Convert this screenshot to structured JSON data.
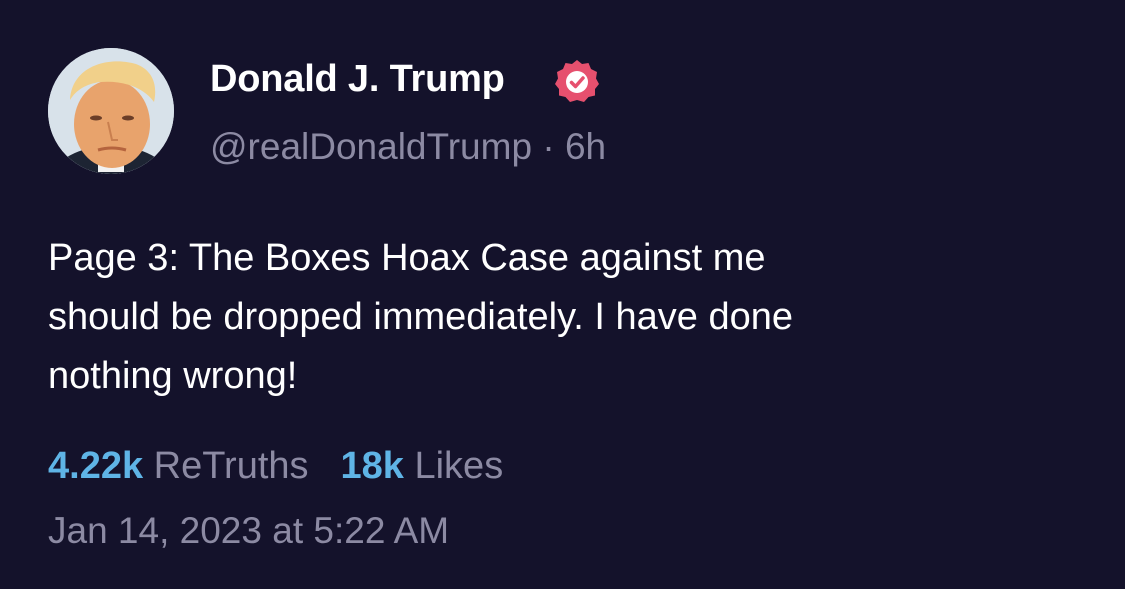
{
  "post": {
    "author": {
      "name": "Donald J. Trump",
      "handle": "@realDonaldTrump",
      "verified": true,
      "verified_color": "#e6506e"
    },
    "separator": " · ",
    "relative_time": "6h",
    "text": "Page 3: The Boxes Hoax Case against me\nshould be dropped immediately. I have done\nnothing wrong!",
    "stats": {
      "retruths": {
        "count": "4.22k",
        "label": "ReTruths"
      },
      "likes": {
        "count": "18k",
        "label": "Likes"
      }
    },
    "timestamp": "Jan 14, 2023 at 5:22 AM"
  },
  "colors": {
    "background": "#14122b",
    "accent": "#5fb4e6",
    "muted": "#8c8aa3"
  }
}
